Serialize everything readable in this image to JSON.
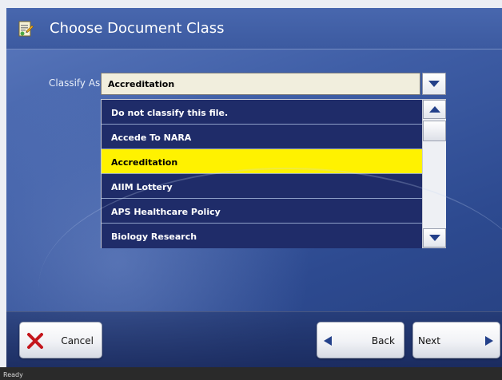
{
  "window": {
    "title": "Choose Document Class",
    "title_icon": "document-class-icon"
  },
  "classify": {
    "label": "Classify As:",
    "selected_value": "Accreditation",
    "dropdown_icon": "chevron-down-icon"
  },
  "list": {
    "items": [
      {
        "label": "Do not classify this file.",
        "selected": false
      },
      {
        "label": "Accede To NARA",
        "selected": false
      },
      {
        "label": "Accreditation",
        "selected": true
      },
      {
        "label": "AIIM Lottery",
        "selected": false
      },
      {
        "label": "APS Healthcare Policy",
        "selected": false
      },
      {
        "label": "Biology Research",
        "selected": false
      }
    ],
    "selected_color": "#fff200",
    "item_color": "#1f2c69"
  },
  "buttons": {
    "cancel_label": "Cancel",
    "back_label": "Back",
    "next_label": "Next"
  },
  "status": {
    "text": "Ready"
  },
  "colors": {
    "accent": "#3f5ea6",
    "cancel_x": "#c4161c",
    "arrow": "#23408a"
  }
}
